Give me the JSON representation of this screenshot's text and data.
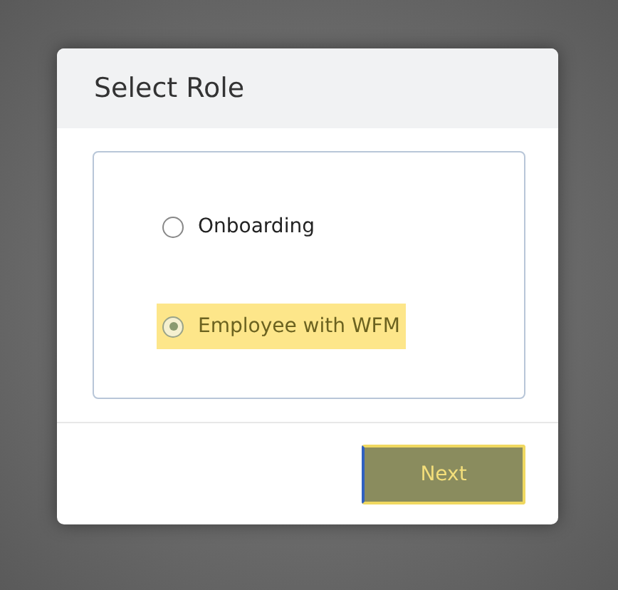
{
  "dialog": {
    "title": "Select Role",
    "options": [
      {
        "label": "Onboarding",
        "selected": false
      },
      {
        "label": "Employee with WFM",
        "selected": true
      }
    ],
    "buttons": [
      {
        "label": "Next"
      }
    ]
  }
}
